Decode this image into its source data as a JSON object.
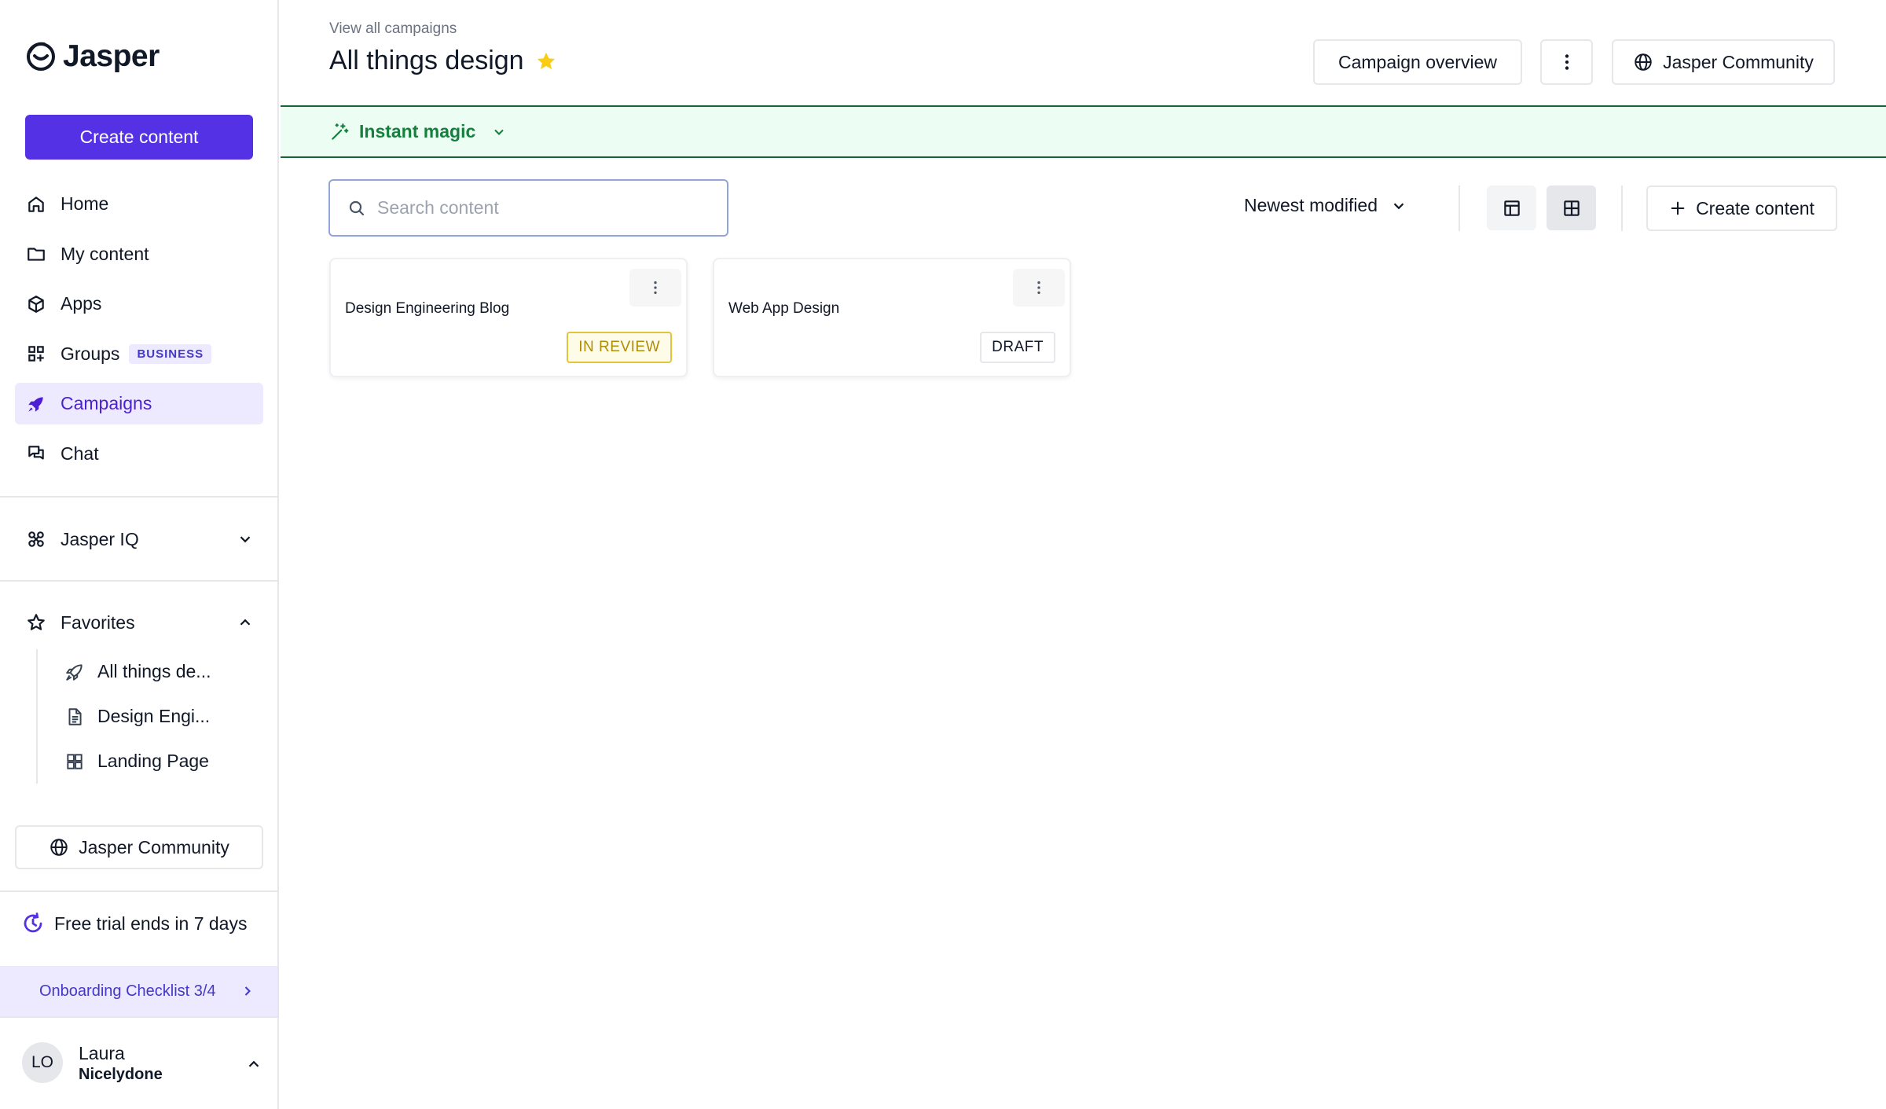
{
  "brand": {
    "name": "Jasper",
    "accent": "#5531e6"
  },
  "sidebar": {
    "create_label": "Create content",
    "nav": [
      {
        "label": "Home",
        "icon": "home-icon"
      },
      {
        "label": "My content",
        "icon": "folder-icon"
      },
      {
        "label": "Apps",
        "icon": "cube-icon"
      },
      {
        "label": "Groups",
        "icon": "groups-icon",
        "badge": "BUSINESS"
      },
      {
        "label": "Campaigns",
        "icon": "rocket-icon",
        "active": true
      },
      {
        "label": "Chat",
        "icon": "chat-icon"
      }
    ],
    "jasper_iq": {
      "label": "Jasper IQ"
    },
    "favorites": {
      "label": "Favorites",
      "items": [
        {
          "label": "All things de...",
          "icon": "rocket-icon"
        },
        {
          "label": "Design Engi...",
          "icon": "document-icon"
        },
        {
          "label": "Landing Page",
          "icon": "grid-icon"
        }
      ]
    },
    "community_label": "Jasper Community",
    "trial_text": "Free trial ends in 7 days",
    "onboarding_label": "Onboarding Checklist 3/4",
    "user": {
      "initials": "LO",
      "first_name": "Laura",
      "last_name": "Nicelydone"
    }
  },
  "header": {
    "breadcrumb": "View all campaigns",
    "title": "All things design",
    "starred": true,
    "overview_label": "Campaign overview",
    "community_label": "Jasper Community"
  },
  "magic_bar": {
    "label": "Instant magic"
  },
  "toolbar": {
    "search_placeholder": "Search content",
    "sort_label": "Newest modified",
    "create_label": "Create content",
    "view_mode": "grid"
  },
  "cards": [
    {
      "title": "Design Engineering Blog",
      "status": "IN REVIEW"
    },
    {
      "title": "Web App Design",
      "status": "DRAFT"
    }
  ]
}
